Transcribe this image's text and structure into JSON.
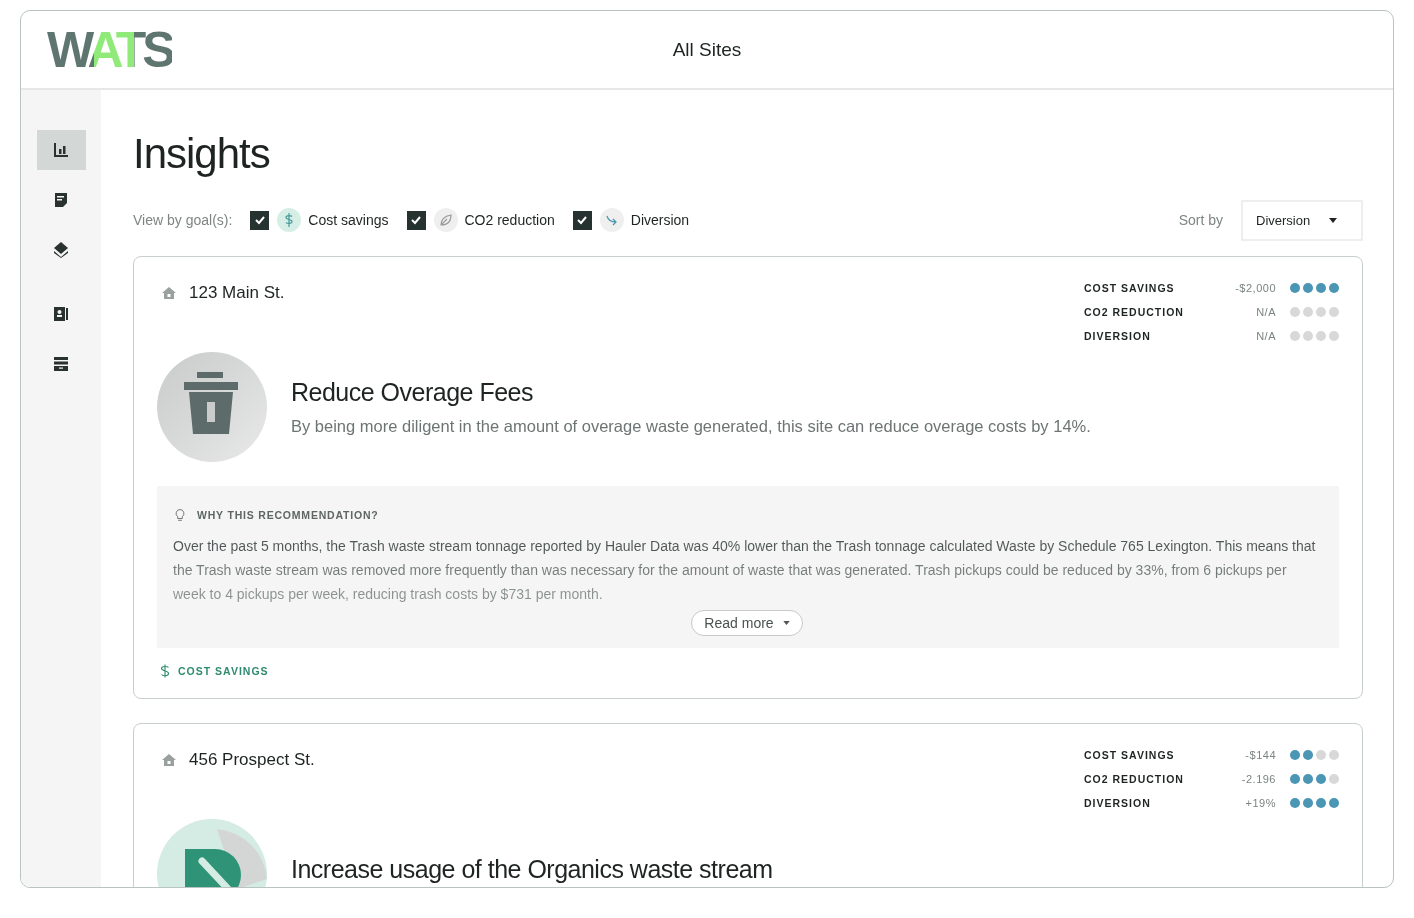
{
  "header": {
    "logo": "WATS",
    "title": "All Sites"
  },
  "sidebar": {
    "items": [
      {
        "selected": true
      },
      {
        "selected": false
      },
      {
        "selected": false
      },
      {
        "selected": false
      },
      {
        "selected": false
      }
    ]
  },
  "page": {
    "title": "Insights",
    "filter_label": "View by goal(s):",
    "goals": [
      {
        "label": "Cost savings",
        "checked": true
      },
      {
        "label": "CO2 reduction",
        "checked": true
      },
      {
        "label": "Diversion",
        "checked": true
      }
    ],
    "sort_label": "Sort by",
    "sort_value": "Diversion"
  },
  "cards": [
    {
      "site": "123 Main St.",
      "metrics": [
        {
          "name": "COST SAVINGS",
          "value": "-$2,000",
          "stars": 4
        },
        {
          "name": "CO2 REDUCTION",
          "value": "N/A",
          "stars": 0
        },
        {
          "name": "DIVERSION",
          "value": "N/A",
          "stars": 0
        }
      ],
      "title": "Reduce Overage Fees",
      "description": "By being more diligent in the amount of overage waste generated, this site can reduce overage costs by 14%.",
      "why": {
        "heading": "WHY THIS RECOMMENDATION?",
        "text": "Over the past 5 months, the Trash waste stream tonnage reported by Hauler Data was 40% lower than the Trash tonnage calculated Waste by Schedule 765 Lexington. This means that the Trash waste stream was removed more frequently than was necessary for the amount of waste that was generated. Trash pickups could be reduced by 33%, from 6 pickups per week to 4 pickups per week, reducing trash costs by $731 per month.",
        "button": "Read more"
      },
      "tag": "COST SAVINGS"
    },
    {
      "site": "456 Prospect St.",
      "metrics": [
        {
          "name": "COST SAVINGS",
          "value": "-$144",
          "stars": 2
        },
        {
          "name": "CO2 REDUCTION",
          "value": "-2.196",
          "stars": 3
        },
        {
          "name": "DIVERSION",
          "value": "+19%",
          "stars": 4
        }
      ],
      "title": "Increase usage of the Organics waste stream"
    }
  ]
}
